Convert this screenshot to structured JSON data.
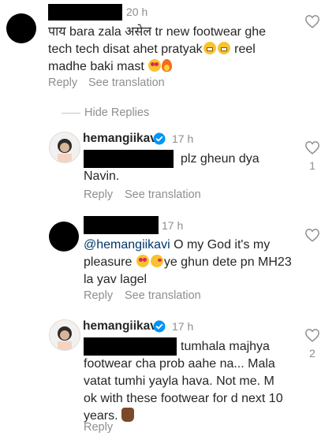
{
  "comment1": {
    "time": "20 h",
    "line1": "पाय bara zala असेल tr new footwear ghe",
    "line2_a": "tech tech disat ahet pratyak",
    "line2_b": " reel",
    "line3": "madhe baki mast ",
    "reply": "Reply",
    "see_translation": "See translation"
  },
  "replies_toggle": "Hide Replies",
  "reply1": {
    "username": "hemangiikavi",
    "time": "17 h",
    "line1": "plz gheun dya",
    "line2": "Navin.",
    "likes": "1",
    "reply": "Reply",
    "see_translation": "See translation"
  },
  "reply2": {
    "time": "17 h",
    "mention": "@hemangiikavi",
    "line1_rest": " O my God it's my",
    "line2_a": "pleasure ",
    "line2_b": "ye ghun dete pn MH23",
    "line3": "la yav lagel",
    "reply": "Reply",
    "see_translation": "See translation"
  },
  "reply3": {
    "username": "hemangiikavi",
    "time": "17 h",
    "line1": "tumhala majhya",
    "line2": "footwear cha prob aahe na... Mala",
    "line3": "vatat tumhi yayla hava. Not me. M",
    "line4": "ok with these footwear for d next 10",
    "line5": "years. ",
    "likes": "2",
    "reply": "Reply"
  },
  "colors": {
    "text": "#262626",
    "secondary": "#8e8e8e",
    "mention": "#00376b",
    "verified": "#0095f6"
  },
  "icons": [
    "heart-outline-icon",
    "verified-badge-icon"
  ]
}
